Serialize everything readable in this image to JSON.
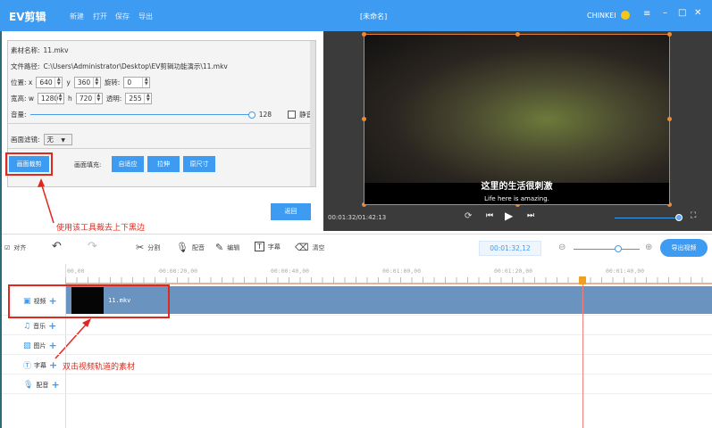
{
  "app": {
    "logo": "EV剪辑",
    "title": "[未命名]",
    "user": "CHINKEI",
    "menu": [
      "新建",
      "打开",
      "保存",
      "导出"
    ]
  },
  "props": {
    "name_label": "素材名称:",
    "name": "11.mkv",
    "path_label": "文件路径:",
    "path": "C:\\Users\\Administrator\\Desktop\\EV剪辑功能演示\\11.mkv",
    "pos_label": "位置: x",
    "x": "640",
    "y_label": "y",
    "y": "360",
    "rot_label": "旋转:",
    "rot": "0",
    "size_label": "宽高: w",
    "w": "1280",
    "h_label": "h",
    "h": "720",
    "alpha_label": "透明:",
    "alpha": "255",
    "volume_label": "音量:",
    "volume": "128",
    "volume_fraction": 1.0,
    "mute_label": "静音",
    "filter_label": "画面滤镜:",
    "filter": "无",
    "crop_button": "画面裁剪",
    "fill_label": "画面填充:",
    "fill_buttons": [
      "自适应",
      "拉伸",
      "原尺寸"
    ],
    "back_button": "返回"
  },
  "preview": {
    "subtitle_cn": "这里的生活很刺激",
    "subtitle_en": "Life here is amazing.",
    "time": "00:01:32/01:42:13",
    "volume_fraction": 0.95
  },
  "toolbar": {
    "align": "对齐",
    "split": "分割",
    "dub": "配音",
    "edit": "编辑",
    "subtitle": "字幕",
    "clear": "清空",
    "timecode": "00:01:32,12",
    "export": "导出视频",
    "zoom_fraction": 0.6
  },
  "ruler": [
    "00,00",
    "00:00:20,00",
    "00:00:40,00",
    "00:01:00,00",
    "00:01:20,00",
    "00:01:40,00"
  ],
  "tracks": [
    {
      "label": "视频",
      "icon": "video-icon"
    },
    {
      "label": "音乐",
      "icon": "music-icon"
    },
    {
      "label": "图片",
      "icon": "image-icon"
    },
    {
      "label": "字幕",
      "icon": "text-icon"
    },
    {
      "label": "配音",
      "icon": "mic-icon"
    }
  ],
  "clip": {
    "name": "11.mkv"
  },
  "annotations": {
    "crop_hint": "使用该工具裁去上下黑边",
    "track_hint": "双击视频轨道的素材"
  },
  "colors": {
    "accent": "#3d9bf2",
    "annotation": "#e0281e",
    "clip": "#6b93bf",
    "playhead": "#f0a020"
  }
}
